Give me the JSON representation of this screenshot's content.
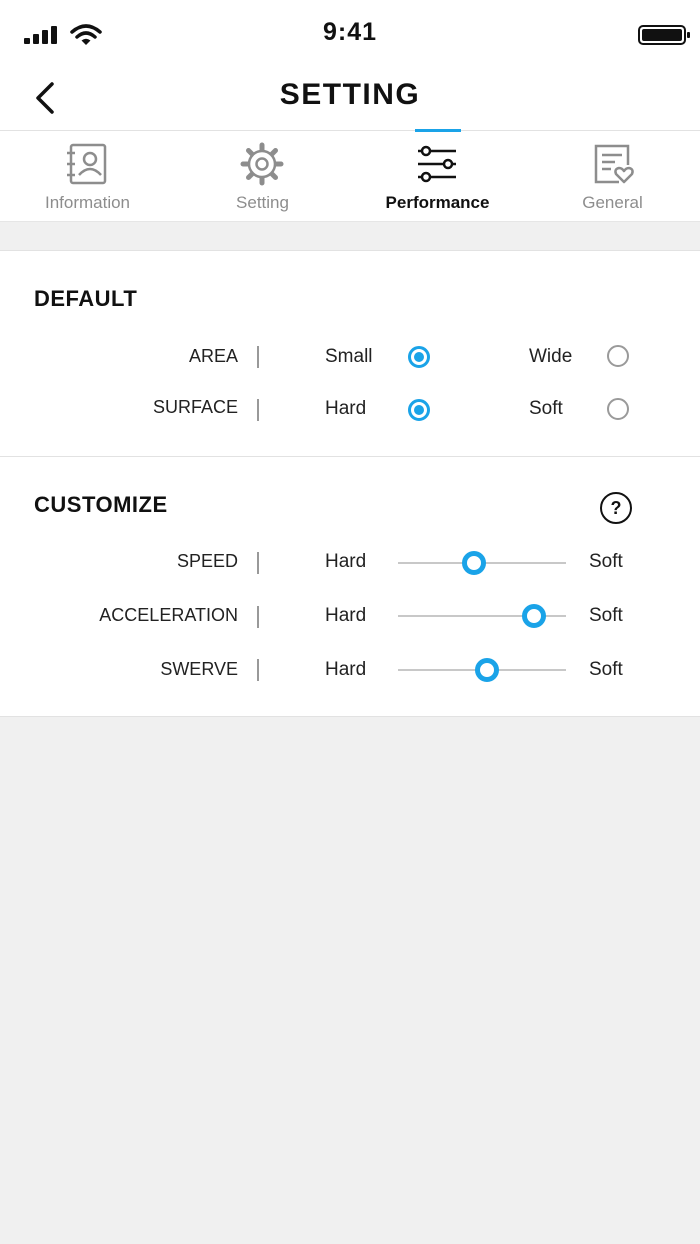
{
  "status": {
    "time": "9:41",
    "signal_icon": "signal-icon",
    "wifi_icon": "wifi-icon",
    "battery_icon": "battery-icon"
  },
  "nav": {
    "title": "SETTING",
    "back_icon": "chevron-left-icon"
  },
  "tabs": [
    {
      "label": "Information",
      "icon": "contact-card-icon",
      "active": false
    },
    {
      "label": "Setting",
      "icon": "gear-icon",
      "active": false
    },
    {
      "label": "Performance",
      "icon": "sliders-icon",
      "active": true
    },
    {
      "label": "General",
      "icon": "document-heart-icon",
      "active": false
    }
  ],
  "default_section": {
    "title": "DEFAULT",
    "rows": [
      {
        "label": "AREA",
        "option_a": "Small",
        "option_b": "Wide",
        "selected": "Small"
      },
      {
        "label": "SURFACE",
        "option_a": "Hard",
        "option_b": "Soft",
        "selected": "Hard"
      }
    ]
  },
  "customize_section": {
    "title": "CUSTOMIZE",
    "help_symbol": "?",
    "rows": [
      {
        "label": "SPEED",
        "min_label": "Hard",
        "max_label": "Soft",
        "value": 0.45
      },
      {
        "label": "ACCELERATION",
        "min_label": "Hard",
        "max_label": "Soft",
        "value": 0.81
      },
      {
        "label": "SWERVE",
        "min_label": "Hard",
        "max_label": "Soft",
        "value": 0.53
      }
    ]
  },
  "colors": {
    "accent": "#1aa3e8",
    "background": "#f0f0f0",
    "inactive": "#8d8d8d"
  }
}
